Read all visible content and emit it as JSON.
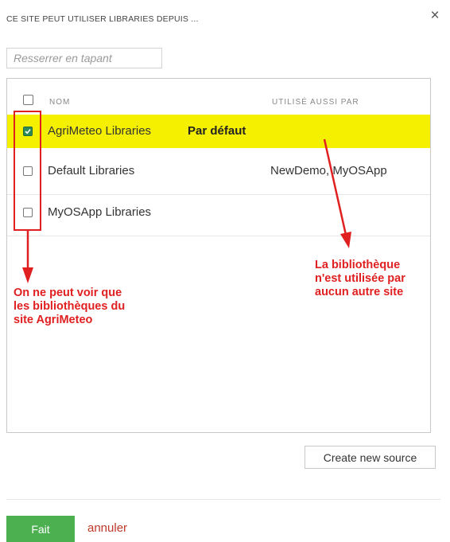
{
  "dialog": {
    "title": "CE SITE PEUT UTILISER LIBRARIES DEPUIS ...",
    "close_icon": "×"
  },
  "filter": {
    "placeholder": "Resserrer en tapant",
    "value": ""
  },
  "table": {
    "columns": [
      "NOM",
      "UTILISÉ AUSSI PAR"
    ],
    "rows": [
      {
        "name": "AgriMeteo Libraries",
        "badge": "Par défaut",
        "used_by": "",
        "checked": true,
        "highlight_color": "#f5f000"
      },
      {
        "name": "Default Libraries",
        "badge": "",
        "used_by": "NewDemo, MyOSApp",
        "checked": false
      },
      {
        "name": "MyOSApp Libraries",
        "badge": "",
        "used_by": "",
        "checked": false
      }
    ]
  },
  "annotations": {
    "left_note": "On ne peut voir que\nles bibliothèques du\nsite AgriMeteo",
    "right_note": "La bibliothèque\nn'est utilisée par\naucun autre site",
    "color": "#e02020"
  },
  "actions": {
    "create_label": "Create new source",
    "done_label": "Fait",
    "cancel_label": "annuler",
    "done_color": "#4caf50",
    "cancel_color": "#c0392b"
  }
}
